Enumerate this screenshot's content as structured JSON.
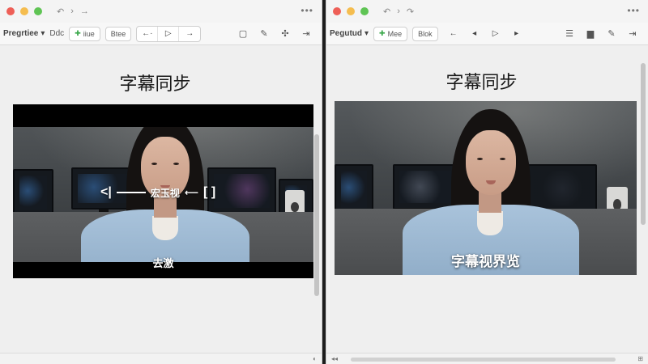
{
  "left_window": {
    "nav": {
      "back": "↶",
      "forward": "→"
    },
    "more": "•••",
    "toolbar": {
      "preset_label": "Pregrtiee",
      "text_label": "Ddc",
      "button_1": "iiue",
      "button_2": "Btee"
    },
    "title": "字幕同步",
    "overlay": {
      "left_marker": "<|",
      "label": "宏玉视",
      "right_marker": "[ ]"
    },
    "caption": "去激"
  },
  "right_window": {
    "nav": {
      "back": "↶",
      "forward": "↷"
    },
    "more": "•••",
    "toolbar": {
      "preset_label": "Pegutud",
      "button_1": "Mee",
      "button_2": "Blok"
    },
    "title": "字幕同步",
    "caption": "字幕视界览"
  },
  "colors": {
    "traffic_red": "#ee5f57",
    "traffic_yellow": "#f5bd4f",
    "traffic_green": "#5fc454",
    "accent_green": "#3aa84b",
    "divider": "#1c1c1c"
  }
}
